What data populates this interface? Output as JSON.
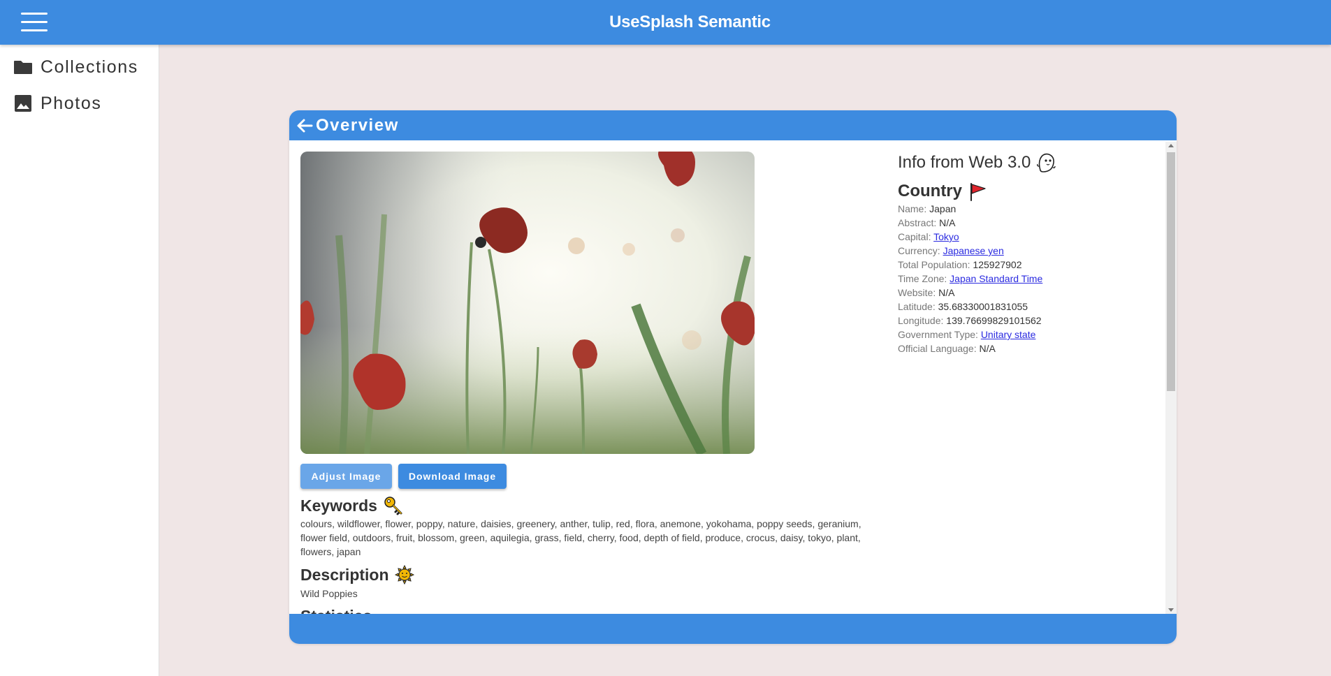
{
  "app": {
    "title": "UseSplash Semantic"
  },
  "sidebar": {
    "items": [
      {
        "label": "Collections",
        "icon": "folder-icon"
      },
      {
        "label": "Photos",
        "icon": "image-icon"
      }
    ]
  },
  "card": {
    "title": "Overview",
    "buttons": {
      "adjust_label": "Adjust Image",
      "download_label": "Download Image"
    },
    "keywords": {
      "heading": "Keywords",
      "text": "colours, wildflower, flower, poppy, nature, daisies, greenery, anther, tulip, red, flora, anemone, yokohama, poppy seeds, geranium, flower field, outdoors, fruit, blossom, green, aquilegia, grass, field, cherry, food, depth of field, produce, crocus, daisy, tokyo, plant, flowers, japan"
    },
    "description": {
      "heading": "Description",
      "text": "Wild Poppies"
    },
    "statistics": {
      "heading": "Statistics"
    },
    "info": {
      "title": "Info from Web 3.0",
      "country_heading": "Country",
      "rows": [
        {
          "key": "Name:",
          "value": "Japan",
          "link": false
        },
        {
          "key": "Abstract:",
          "value": "N/A",
          "link": false
        },
        {
          "key": "Capital:",
          "value": "Tokyo",
          "link": true
        },
        {
          "key": "Currency:",
          "value": "Japanese yen",
          "link": true
        },
        {
          "key": "Total Population:",
          "value": "125927902",
          "link": false
        },
        {
          "key": "Time Zone:",
          "value": "Japan Standard Time",
          "link": true
        },
        {
          "key": "Website:",
          "value": "N/A",
          "link": false
        },
        {
          "key": "Latitude:",
          "value": "35.68330001831055",
          "link": false
        },
        {
          "key": "Longitude:",
          "value": "139.76699829101562",
          "link": false
        },
        {
          "key": "Government Type:",
          "value": "Unitary state",
          "link": true
        },
        {
          "key": "Official Language:",
          "value": "N/A",
          "link": false
        }
      ]
    }
  },
  "colors": {
    "primary": "#3d8be0",
    "primary_light": "#6aa6e8",
    "background": "#f0e6e6",
    "link": "#2a2ae0"
  }
}
